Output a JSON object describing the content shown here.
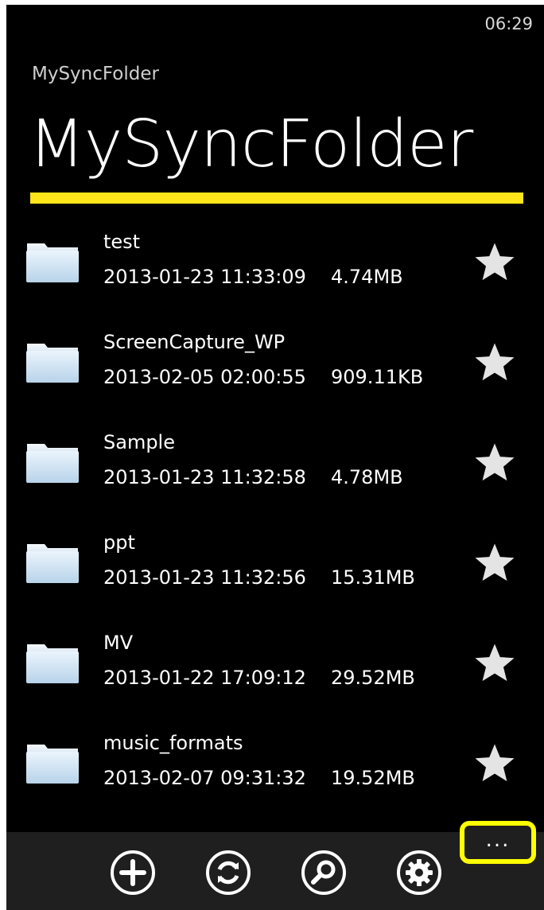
{
  "status_bar": {
    "time": "06:29"
  },
  "header": {
    "app_name": "MySyncFolder",
    "title": "MySyncFolder",
    "accent_color": "#ffe51a"
  },
  "files": [
    {
      "name": "test",
      "date": "2013-01-23 11:33:09",
      "size": "4.74MB"
    },
    {
      "name": "ScreenCapture_WP",
      "date": "2013-02-05 02:00:55",
      "size": "909.11KB"
    },
    {
      "name": "Sample",
      "date": "2013-01-23 11:32:58",
      "size": "4.78MB"
    },
    {
      "name": "ppt",
      "date": "2013-01-23 11:32:56",
      "size": "15.31MB"
    },
    {
      "name": "MV",
      "date": "2013-01-22 17:09:12",
      "size": "29.52MB"
    },
    {
      "name": "music_formats",
      "date": "2013-02-07 09:31:32",
      "size": "19.52MB"
    }
  ],
  "app_bar": {
    "buttons": [
      "add-icon",
      "sync-icon",
      "search-icon",
      "settings-icon"
    ],
    "more_label": "...",
    "highlight_color": "#ffff00"
  }
}
